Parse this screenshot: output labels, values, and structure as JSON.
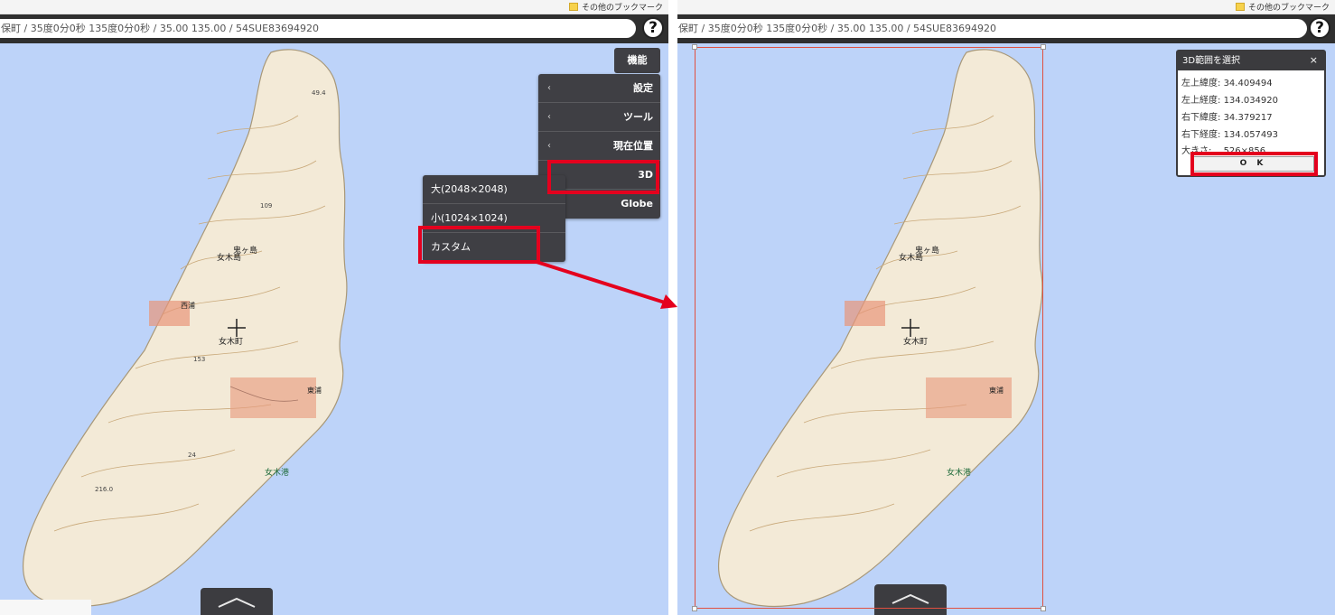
{
  "bookmarks": {
    "other_bookmarks": "その他のブックマーク"
  },
  "address": {
    "left_text": "保町 / 35度0分0秒 135度0分0秒 / 35.00 135.00 / 54SUE83694920",
    "right_text": "保町 / 35度0分0秒 135度0分0秒 / 35.00 135.00 / 54SUE83694920"
  },
  "help": {
    "label": "?"
  },
  "function_button": {
    "label": "機能"
  },
  "main_menu": {
    "items": [
      {
        "label": "設定",
        "chevron": "‹"
      },
      {
        "label": "ツール",
        "chevron": "‹"
      },
      {
        "label": "現在位置",
        "chevron": "‹"
      },
      {
        "label": "3D",
        "chevron": ""
      },
      {
        "label": "Globe",
        "chevron": ""
      }
    ]
  },
  "submenu_3d": {
    "items": [
      {
        "label": "大(2048×2048)"
      },
      {
        "label": "小(1024×1024)"
      },
      {
        "label": "カスタム"
      }
    ]
  },
  "map_labels": {
    "island_name_1": "女木島",
    "island_name_2": "鬼ヶ島",
    "town": "女木町",
    "west": "西浦",
    "east": "東浦",
    "port": "女木港",
    "elev_top": "49.4",
    "elev_mid": "109",
    "elev_low": "216.0",
    "elev_153": "153",
    "elev_24": "24"
  },
  "dialog_3d": {
    "title": "3D範囲を選択",
    "close": "×",
    "rows": [
      {
        "label": "左上緯度:",
        "value": "34.409494"
      },
      {
        "label": "左上経度:",
        "value": "134.034920"
      },
      {
        "label": "右下緯度:",
        "value": "34.379217"
      },
      {
        "label": "右下経度:",
        "value": "134.057493"
      },
      {
        "label": "大きさ:",
        "value": "526×856"
      }
    ],
    "ok_label": "O K"
  },
  "colors": {
    "sea": "#bdd3f9",
    "menu_bg": "#3f3f44",
    "highlight": "#e4001e",
    "land": "#f3ead7"
  },
  "icons": {
    "up_tab": "chevron-up-icon",
    "folder": "folder-icon",
    "crosshair": "crosshair-icon",
    "arrow": "arrow-annotation"
  }
}
